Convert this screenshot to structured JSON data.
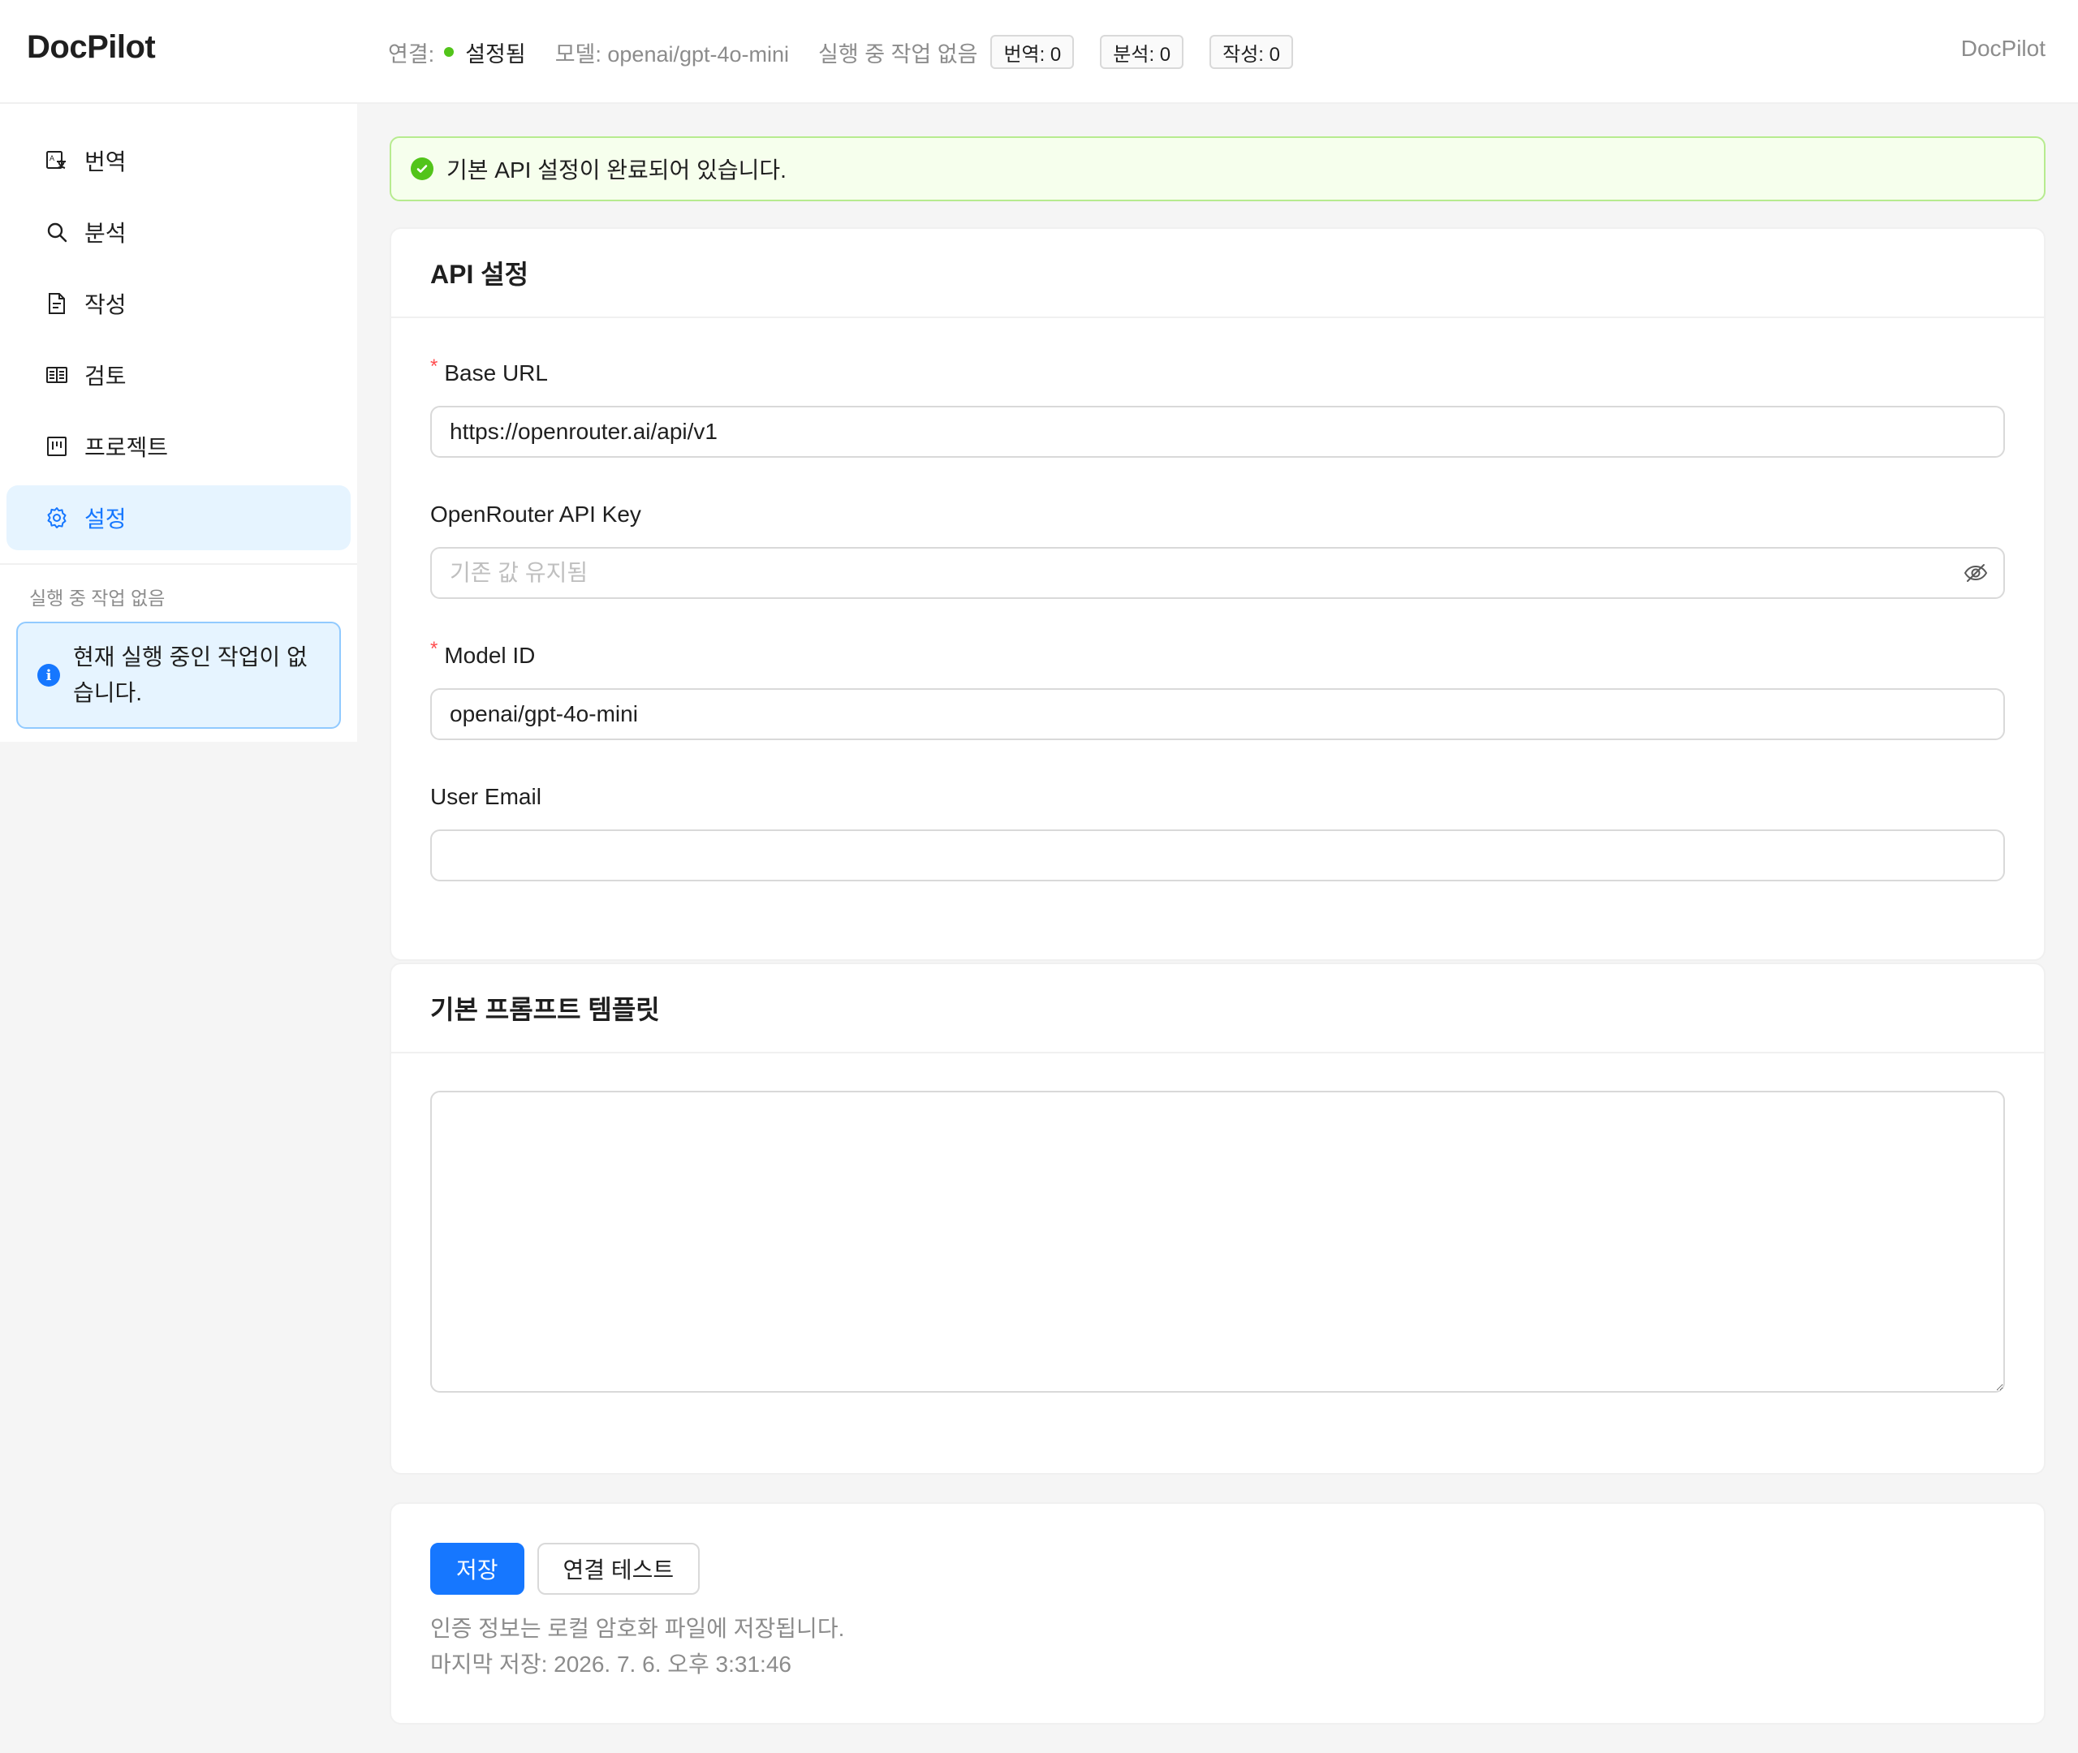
{
  "app": {
    "logo": "DocPilot",
    "header_right": "DocPilot"
  },
  "status": {
    "connection_label": "연결:",
    "connection_value": "설정됨",
    "model": "모델: openai/gpt-4o-mini",
    "idle": "실행 중 작업 없음",
    "tags": [
      "번역: 0",
      "분석: 0",
      "작성: 0"
    ],
    "connection_color": "#52c41a"
  },
  "sidebar": {
    "items": [
      {
        "label": "번역",
        "icon": "translate-icon"
      },
      {
        "label": "분석",
        "icon": "search-icon"
      },
      {
        "label": "작성",
        "icon": "file-text-icon"
      },
      {
        "label": "검토",
        "icon": "read-icon"
      },
      {
        "label": "프로젝트",
        "icon": "project-icon"
      },
      {
        "label": "설정",
        "icon": "gear-icon",
        "active": true
      }
    ],
    "section_title": "실행 중 작업 없음",
    "alert_text": "현재 실행 중인 작업이 없습니다.",
    "alert_icon": "info-icon"
  },
  "main": {
    "success_alert": "기본 API 설정이 완료되어 있습니다.",
    "api_card": {
      "title": "API 설정",
      "base_url": {
        "label": "Base URL",
        "value": "https://openrouter.ai/api/v1",
        "required": true
      },
      "api_key": {
        "label": "OpenRouter API Key",
        "value": "",
        "placeholder": "기존 값 유지됨"
      },
      "model_id": {
        "label": "Model ID",
        "value": "openai/gpt-4o-mini",
        "required": true
      },
      "user_email": {
        "label": "User Email",
        "value": ""
      }
    },
    "prompt_card": {
      "title": "기본 프롬프트 템플릿",
      "value": ""
    },
    "actions": {
      "save_label": "저장",
      "test_label": "연결 테스트",
      "note_storage": "인증 정보는 로컬 암호화 파일에 저장됩니다.",
      "note_last_saved": "마지막 저장: 2026. 7. 6. 오후 3:31:46"
    }
  },
  "colors": {
    "primary": "#1677ff",
    "success_bg": "#f6ffed",
    "success_border": "#b7eb8f",
    "info_bg": "#e6f4ff",
    "info_border": "#91caff",
    "required": "#ff4d4f"
  }
}
